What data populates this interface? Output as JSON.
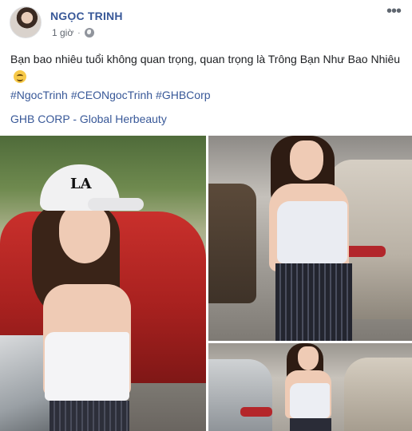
{
  "post": {
    "author": "NGỌC TRINH",
    "time": "1 giờ",
    "separator": "·",
    "more_label": "•••",
    "text": "Bạn bao nhiêu tuổi không quan trọng, quan trọng là Trông Bạn Như Bao Nhiêu",
    "emoji": "smiling-face-emoji",
    "hashtags": [
      "#NgocTrinh",
      "#CEONgocTrinh",
      "#GHBCorp"
    ],
    "brand_line": "GHB CORP - Global Herbeauty",
    "cap_logo": "LA"
  },
  "colors": {
    "link": "#385898",
    "text": "#1c1e21",
    "meta": "#616770"
  },
  "icons": {
    "privacy": "globe-icon",
    "menu": "more-icon"
  }
}
